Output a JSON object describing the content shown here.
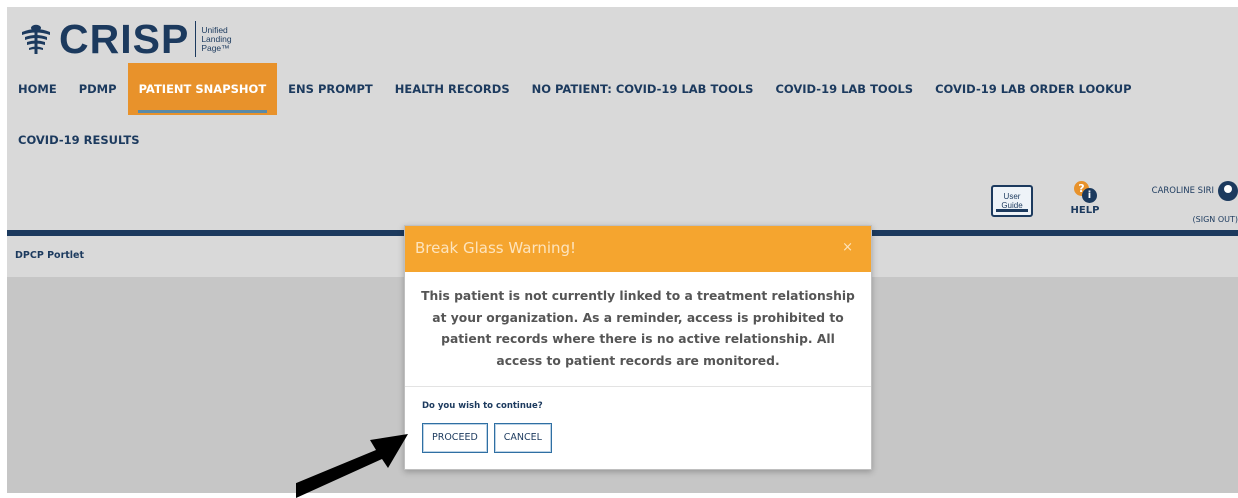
{
  "logo": {
    "brand": "CRISP",
    "tagline_lines": [
      "Unified",
      "Landing",
      "Page™"
    ],
    "icon": "crisp-caduceus-icon"
  },
  "nav": {
    "items": [
      {
        "label": "HOME",
        "active": false
      },
      {
        "label": "PDMP",
        "active": false
      },
      {
        "label": "PATIENT SNAPSHOT",
        "active": true
      },
      {
        "label": "ENS PROMPT",
        "active": false
      },
      {
        "label": "HEALTH RECORDS",
        "active": false
      },
      {
        "label": "NO PATIENT: COVID-19 LAB TOOLS",
        "active": false
      },
      {
        "label": "COVID-19 LAB TOOLS",
        "active": false
      },
      {
        "label": "COVID-19 LAB ORDER LOOKUP",
        "active": false
      }
    ],
    "row2": [
      {
        "label": "COVID-19 RESULTS",
        "active": false
      }
    ]
  },
  "utility": {
    "user_guide_lines": [
      "User",
      "Guide"
    ],
    "help_label": "HELP",
    "user_name": "CAROLINE SIRI",
    "sign_out": "(SIGN OUT)"
  },
  "portlet": {
    "title": "DPCP Portlet"
  },
  "modal": {
    "title": "Break Glass Warning!",
    "close": "×",
    "message": "This patient is not currently linked to a treatment relationship at your organization. As a reminder, access is prohibited to patient records where there is no active relationship. All access to patient records are monitored.",
    "question": "Do you wish to continue?",
    "proceed_label": "PROCEED",
    "cancel_label": "CANCEL"
  },
  "colors": {
    "brand_navy": "#1c3a5e",
    "active_orange": "#e8922b",
    "modal_header": "#f5a52f",
    "background": "#d9d9d9"
  }
}
